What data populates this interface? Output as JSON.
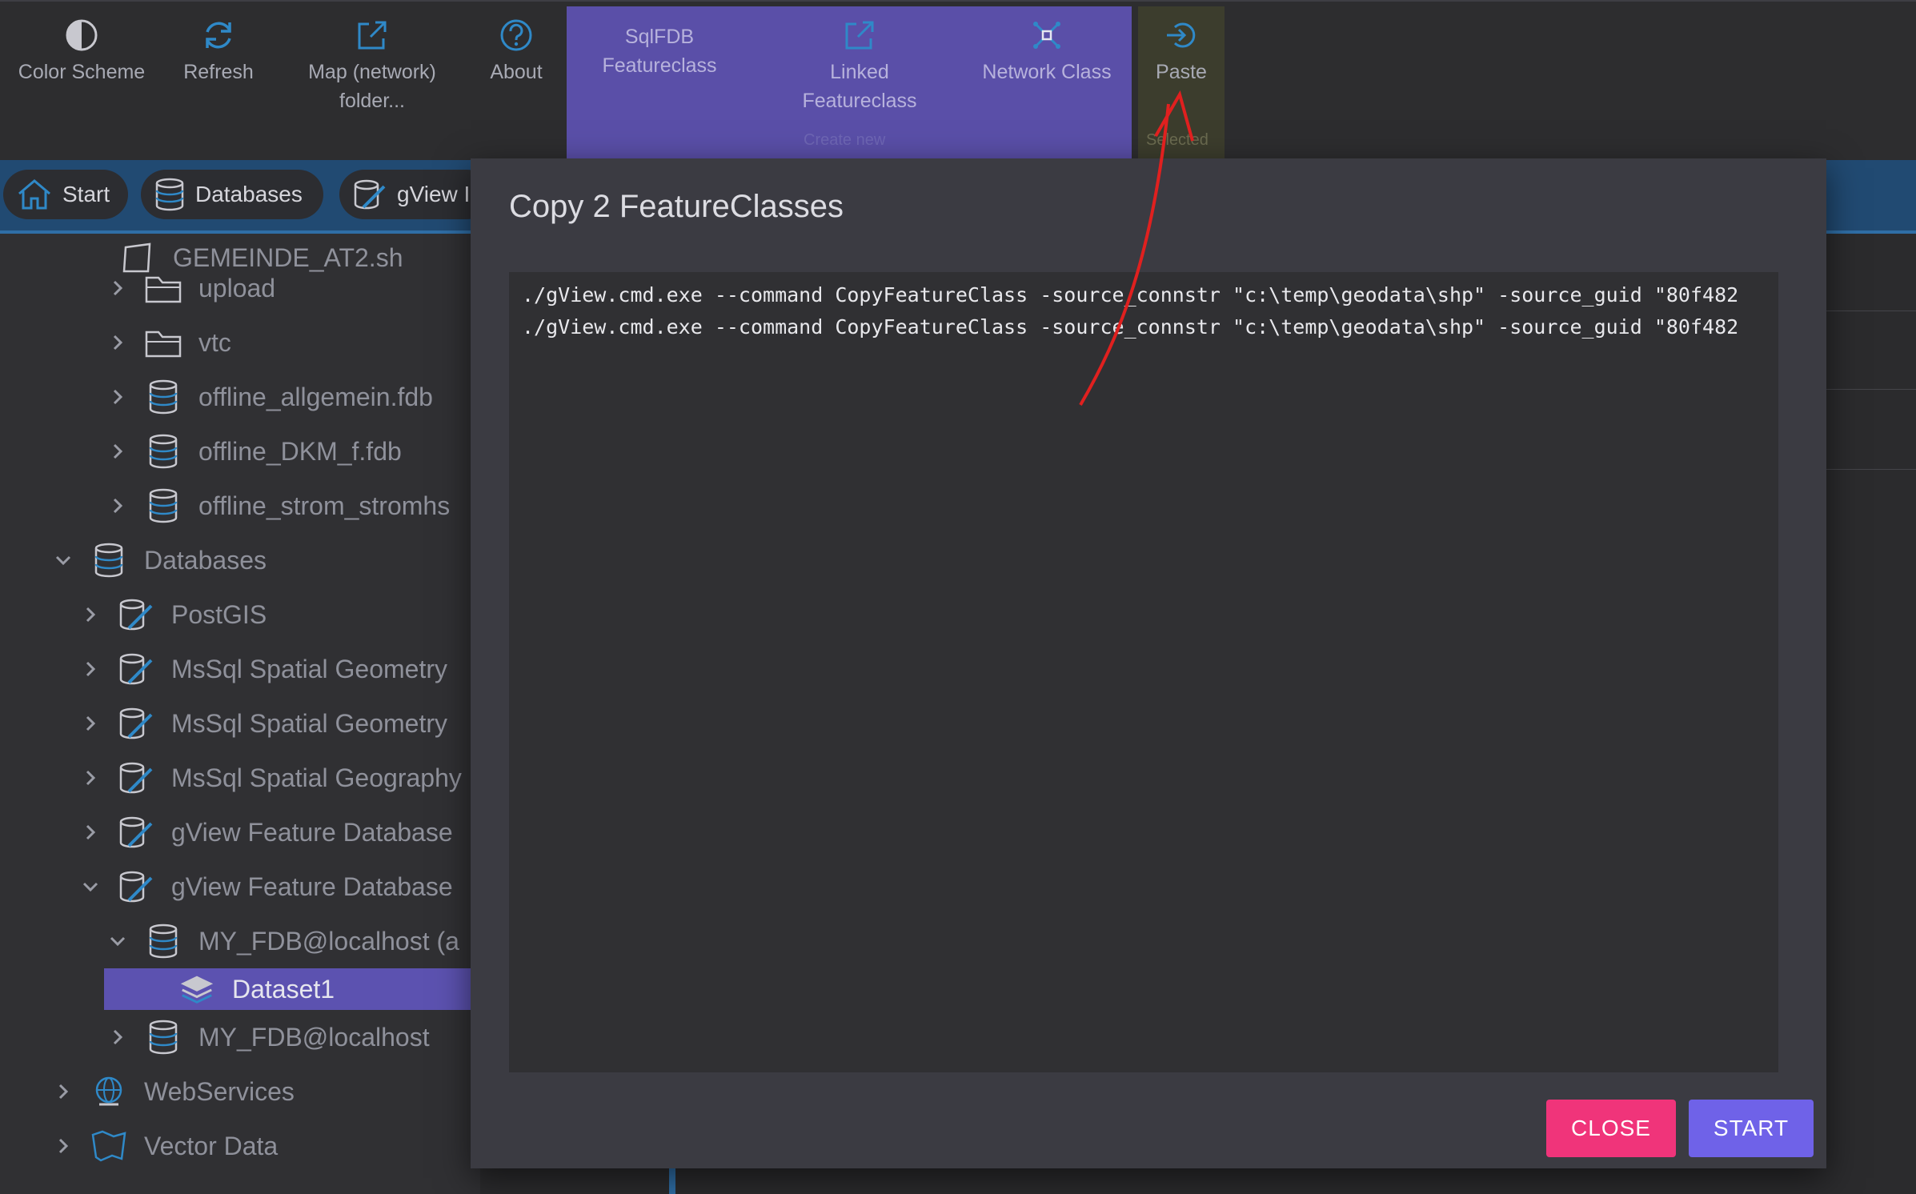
{
  "toolbar": {
    "color_scheme": "Color Scheme",
    "refresh": "Refresh",
    "map_folder_line1": "Map (network)",
    "map_folder_line2": "folder...",
    "about": "About",
    "sqlfdb_line1": "SqlFDB",
    "sqlfdb_line2": "Featureclass",
    "linked_line1": "Linked",
    "linked_line2": "Featureclass",
    "network_class": "Network Class",
    "create_new_caption": "Create new",
    "paste": "Paste",
    "selected_caption": "Selected"
  },
  "breadcrumb": {
    "items": [
      {
        "label": "Start",
        "icon": "home-icon"
      },
      {
        "label": "Databases",
        "icon": "database-icon"
      },
      {
        "label": "gView I",
        "icon": "pencil-database-icon"
      }
    ]
  },
  "tree": {
    "items": [
      {
        "label": "GEMEINDE_AT2.sh",
        "icon": "polygon-icon",
        "expander": "none"
      },
      {
        "label": "upload",
        "icon": "folder-icon",
        "expander": "collapsed"
      },
      {
        "label": "vtc",
        "icon": "folder-icon",
        "expander": "collapsed"
      },
      {
        "label": "offline_allgemein.fdb",
        "icon": "database-icon",
        "expander": "collapsed"
      },
      {
        "label": "offline_DKM_f.fdb",
        "icon": "database-icon",
        "expander": "collapsed"
      },
      {
        "label": "offline_strom_stromhs",
        "icon": "database-icon",
        "expander": "collapsed"
      },
      {
        "label": "Databases",
        "icon": "database-icon",
        "expander": "expanded"
      },
      {
        "label": "PostGIS",
        "icon": "pencil-database-icon",
        "expander": "collapsed"
      },
      {
        "label": "MsSql Spatial Geometry",
        "icon": "pencil-database-icon",
        "expander": "collapsed"
      },
      {
        "label": "MsSql Spatial Geometry",
        "icon": "pencil-database-icon",
        "expander": "collapsed"
      },
      {
        "label": "MsSql Spatial Geography",
        "icon": "pencil-database-icon",
        "expander": "collapsed"
      },
      {
        "label": "gView Feature Database",
        "icon": "pencil-database-icon",
        "expander": "collapsed"
      },
      {
        "label": "gView Feature Database",
        "icon": "pencil-database-icon",
        "expander": "expanded"
      },
      {
        "label": "MY_FDB@localhost (a",
        "icon": "database-icon",
        "expander": "expanded"
      },
      {
        "label": "Dataset1",
        "icon": "layers-icon",
        "expander": "none",
        "selected": true
      },
      {
        "label": "MY_FDB@localhost",
        "icon": "database-icon",
        "expander": "collapsed"
      },
      {
        "label": "WebServices",
        "icon": "globe-icon",
        "expander": "collapsed"
      },
      {
        "label": "Vector Data",
        "icon": "map-icon",
        "expander": "collapsed"
      }
    ]
  },
  "dialog": {
    "title": "Copy 2 FeatureClasses",
    "lines": [
      "./gView.cmd.exe --command CopyFeatureClass -source_connstr \"c:\\temp\\geodata\\shp\" -source_guid \"80f482",
      "./gView.cmd.exe --command CopyFeatureClass -source_connstr \"c:\\temp\\geodata\\shp\" -source_guid \"80f482"
    ],
    "close_label": "CLOSE",
    "start_label": "START"
  },
  "colors": {
    "accent": "#5c52b0",
    "close_button": "#f0347a",
    "start_button": "#6f62e8",
    "annotation_arrow": "#e0201f"
  }
}
